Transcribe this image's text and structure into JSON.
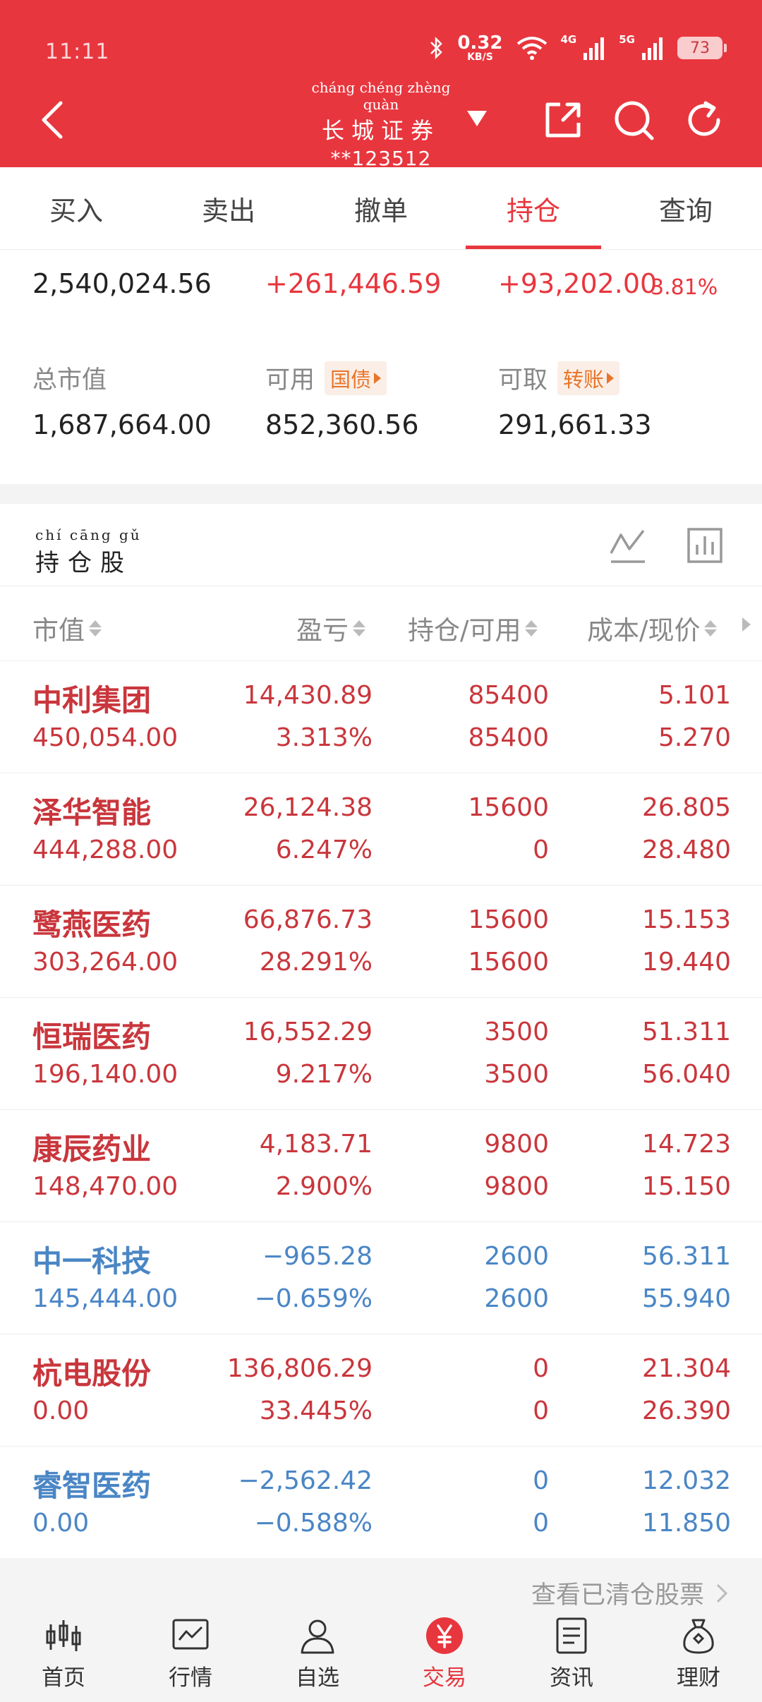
{
  "status_bar": {
    "time": "11:11",
    "net_speed": "0.32",
    "net_unit": "KB/S",
    "sig1": "4G",
    "sig2": "5G",
    "battery": "73"
  },
  "header": {
    "broker_pinyin": "cháng chéng zhèng quàn",
    "broker_name": "长城证券",
    "account": "**123512"
  },
  "tabs": [
    {
      "label": "买入"
    },
    {
      "label": "卖出"
    },
    {
      "label": "撤单"
    },
    {
      "label": "持仓"
    },
    {
      "label": "查询"
    }
  ],
  "summary": {
    "total_assets": "2,540,024.56",
    "profit": "+261,446.59",
    "daily_profit": "+93,202.00",
    "daily_pct": "3.81%",
    "market_value_label": "总市值",
    "market_value": "1,687,664.00",
    "available_label": "可用",
    "available_chip": "国债",
    "available": "852,360.56",
    "withdrawable_label": "可取",
    "withdrawable_chip": "转账",
    "withdrawable": "291,661.33"
  },
  "holdings": {
    "title_pinyin": "chí cāng gǔ",
    "title": "持仓股",
    "columns": [
      "市值",
      "盈亏",
      "持仓/可用",
      "成本/现价"
    ],
    "rows": [
      {
        "name": "中利集团",
        "mv": "450,054.00",
        "pl": "14,430.89",
        "pl_pct": "3.313%",
        "hold": "85400",
        "avail": "85400",
        "cost": "5.101",
        "price": "5.270",
        "trend": "up"
      },
      {
        "name": "泽华智能",
        "mv": "444,288.00",
        "pl": "26,124.38",
        "pl_pct": "6.247%",
        "hold": "15600",
        "avail": "0",
        "cost": "26.805",
        "price": "28.480",
        "trend": "up"
      },
      {
        "name": "鹭燕医药",
        "mv": "303,264.00",
        "pl": "66,876.73",
        "pl_pct": "28.291%",
        "hold": "15600",
        "avail": "15600",
        "cost": "15.153",
        "price": "19.440",
        "trend": "up"
      },
      {
        "name": "恒瑞医药",
        "mv": "196,140.00",
        "pl": "16,552.29",
        "pl_pct": "9.217%",
        "hold": "3500",
        "avail": "3500",
        "cost": "51.311",
        "price": "56.040",
        "trend": "up"
      },
      {
        "name": "康辰药业",
        "mv": "148,470.00",
        "pl": "4,183.71",
        "pl_pct": "2.900%",
        "hold": "9800",
        "avail": "9800",
        "cost": "14.723",
        "price": "15.150",
        "trend": "up"
      },
      {
        "name": "中一科技",
        "mv": "145,444.00",
        "pl": "−965.28",
        "pl_pct": "−0.659%",
        "hold": "2600",
        "avail": "2600",
        "cost": "56.311",
        "price": "55.940",
        "trend": "dn"
      },
      {
        "name": "杭电股份",
        "mv": "0.00",
        "pl": "136,806.29",
        "pl_pct": "33.445%",
        "hold": "0",
        "avail": "0",
        "cost": "21.304",
        "price": "26.390",
        "trend": "up"
      },
      {
        "name": "睿智医药",
        "mv": "0.00",
        "pl": "−2,562.42",
        "pl_pct": "−0.588%",
        "hold": "0",
        "avail": "0",
        "cost": "12.032",
        "price": "11.850",
        "trend": "dn"
      }
    ]
  },
  "cleared_link": "查看已清仓股票",
  "bottom_nav": [
    {
      "label": "首页",
      "icon": "candlestick-icon"
    },
    {
      "label": "行情",
      "icon": "market-chart-icon"
    },
    {
      "label": "自选",
      "icon": "user-icon"
    },
    {
      "label": "交易",
      "icon": "yuan-coin-icon"
    },
    {
      "label": "资讯",
      "icon": "news-icon"
    },
    {
      "label": "理财",
      "icon": "money-bag-icon"
    }
  ],
  "colors": {
    "brand_red": "#e8363e",
    "gain": "#c9363c",
    "loss": "#4a86c5",
    "chip_orange": "#e8752a"
  }
}
